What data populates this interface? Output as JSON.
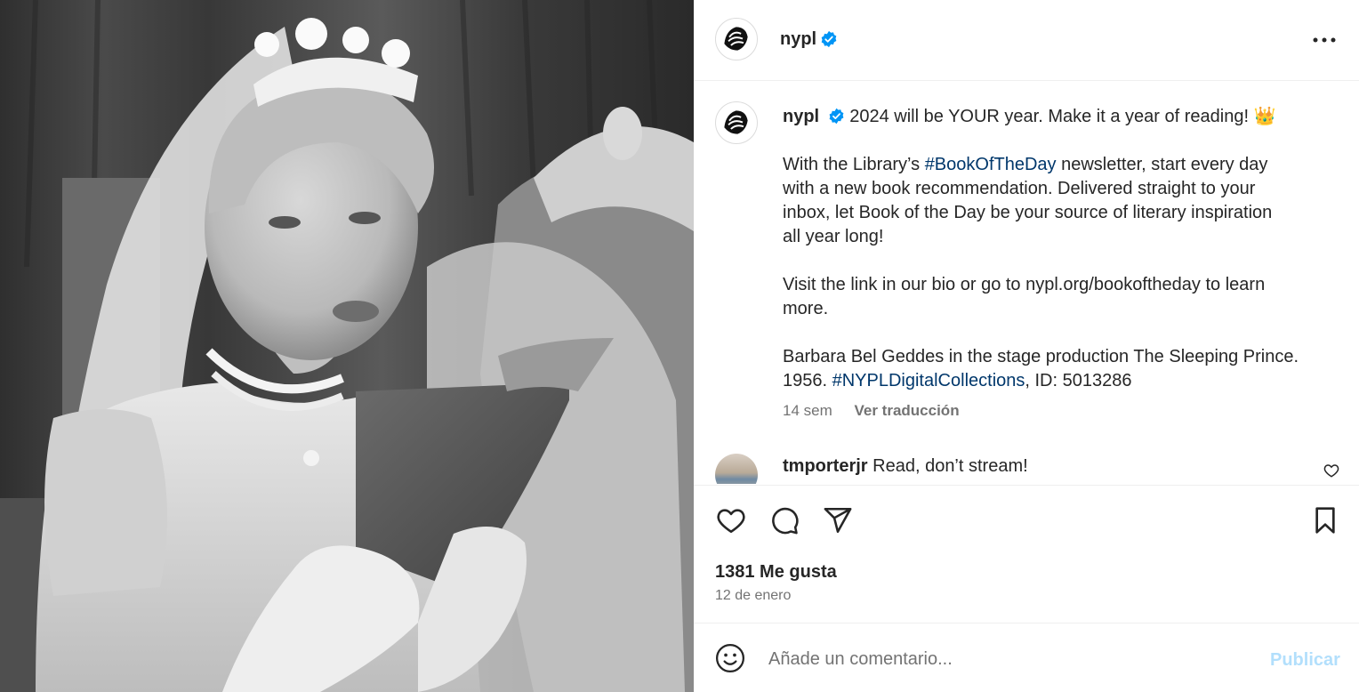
{
  "photo": {
    "alt_icon": "photo-image"
  },
  "header": {
    "username": "nypl",
    "verified_icon": "verified-badge-icon",
    "more_icon": "more-options-icon"
  },
  "post": {
    "username": "nypl",
    "caption_line1": "2024 will be YOUR year. Make it a year of reading!",
    "caption_emoji": "👑",
    "para2_before": "With the Library’s ",
    "para2_tag": "#BookOfTheDay",
    "para2_line1_after": " newsletter, start every day",
    "para2_line2": "with a new book recommendation. Delivered straight to your",
    "para2_line3": "inbox, let Book of the Day be your source of literary inspiration",
    "para2_line4": "all year long!",
    "para3_line1": "Visit the link in our bio or go to nypl.org/bookoftheday to learn",
    "para3_line2": "more.",
    "para4_line1": "Barbara Bel Geddes in the stage production The Sleeping Prince.",
    "para4_line2_before": "1956. ",
    "para4_tag": "#NYPLDigitalCollections",
    "para4_line2_after": ", ID: 5013286",
    "time_ago": "14 sem",
    "translate_label": "Ver traducción"
  },
  "comments": [
    {
      "username": "tmporterjr",
      "text": "Read, don’t stream!"
    }
  ],
  "actions": {
    "icons": [
      "heart-icon",
      "comment-icon",
      "share-icon",
      "bookmark-icon"
    ],
    "likes": "1381 Me gusta",
    "date": "12 de enero"
  },
  "add_comment": {
    "placeholder": "Añade un comentario...",
    "post_label": "Publicar",
    "post_color": "#b2dffc"
  },
  "colors": {
    "hashtag": "#00376b",
    "verified": "#0095f6",
    "secondary_text": "#737373"
  }
}
